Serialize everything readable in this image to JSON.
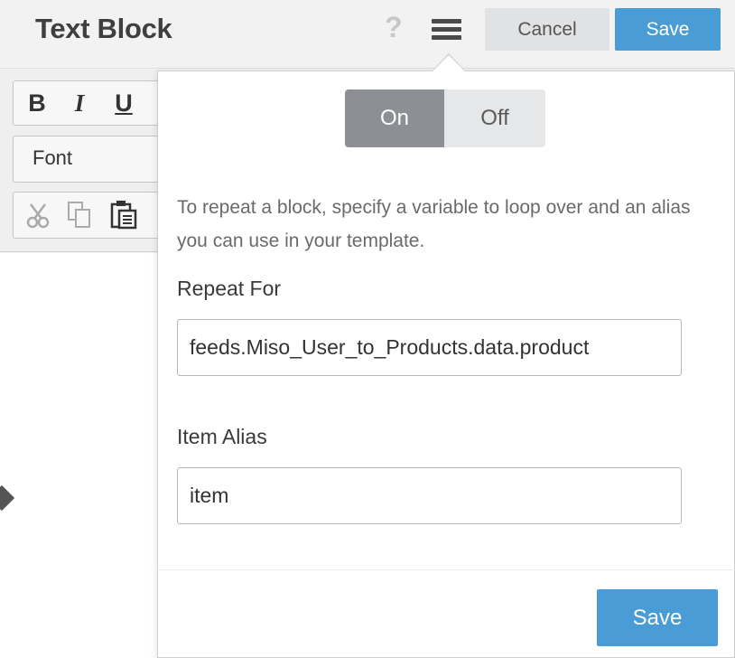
{
  "header": {
    "title": "Text Block",
    "help_glyph": "?",
    "cancel_label": "Cancel",
    "save_label": "Save"
  },
  "toolbar": {
    "bold": "B",
    "italic": "I",
    "underline": "U",
    "font_label": "Font",
    "icons": [
      "cut-icon",
      "copy-icon",
      "paste-icon"
    ]
  },
  "popover": {
    "toggle": {
      "on_label": "On",
      "off_label": "Off",
      "selected": "On"
    },
    "description": "To repeat a block, specify a variable to loop over and an alias you can use in your template.",
    "repeat_for": {
      "label": "Repeat For",
      "value": "feeds.Miso_User_to_Products.data.product"
    },
    "item_alias": {
      "label": "Item Alias",
      "value": "item"
    },
    "save_label": "Save"
  },
  "colors": {
    "primary": "#4a9cd6",
    "toggle_active": "#8c9095",
    "toggle_inactive": "#e6e7e8"
  }
}
